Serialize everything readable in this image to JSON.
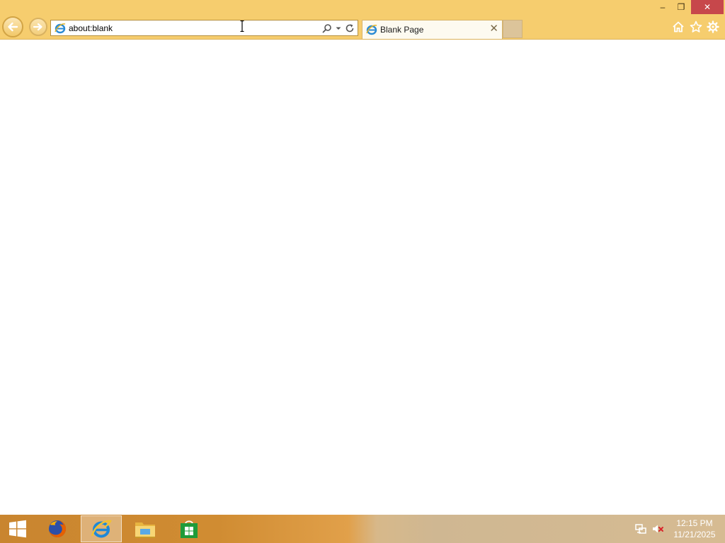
{
  "window": {
    "caption": {
      "minimize_glyph": "–",
      "maximize_glyph": "❐",
      "close_glyph": "✕"
    },
    "address_bar": {
      "url": "about:blank",
      "icons": [
        "ie-page-icon",
        "search-icon",
        "dropdown-arrow-icon",
        "refresh-icon"
      ]
    },
    "tabs": [
      {
        "title": "Blank Page",
        "icon": "ie-page-icon",
        "close_glyph": "✕",
        "active": true
      }
    ],
    "toolbar_icons": [
      "home-icon",
      "favorites-star-icon",
      "settings-gear-icon"
    ],
    "colors": {
      "chrome": "#f6cd6e",
      "close_button": "#c7474b",
      "page_background": "#ffffff"
    }
  },
  "taskbar": {
    "apps": [
      {
        "name": "Firefox",
        "icon": "firefox-icon",
        "active": false
      },
      {
        "name": "Internet Explorer",
        "icon": "internet-explorer-icon",
        "active": true
      },
      {
        "name": "File Explorer",
        "icon": "file-explorer-icon",
        "active": false
      },
      {
        "name": "Store",
        "icon": "store-icon",
        "active": false
      }
    ],
    "tray": {
      "icons": [
        "network-icon",
        "volume-muted-icon"
      ],
      "time": "12:15 PM",
      "date": "11/21/2025"
    }
  }
}
